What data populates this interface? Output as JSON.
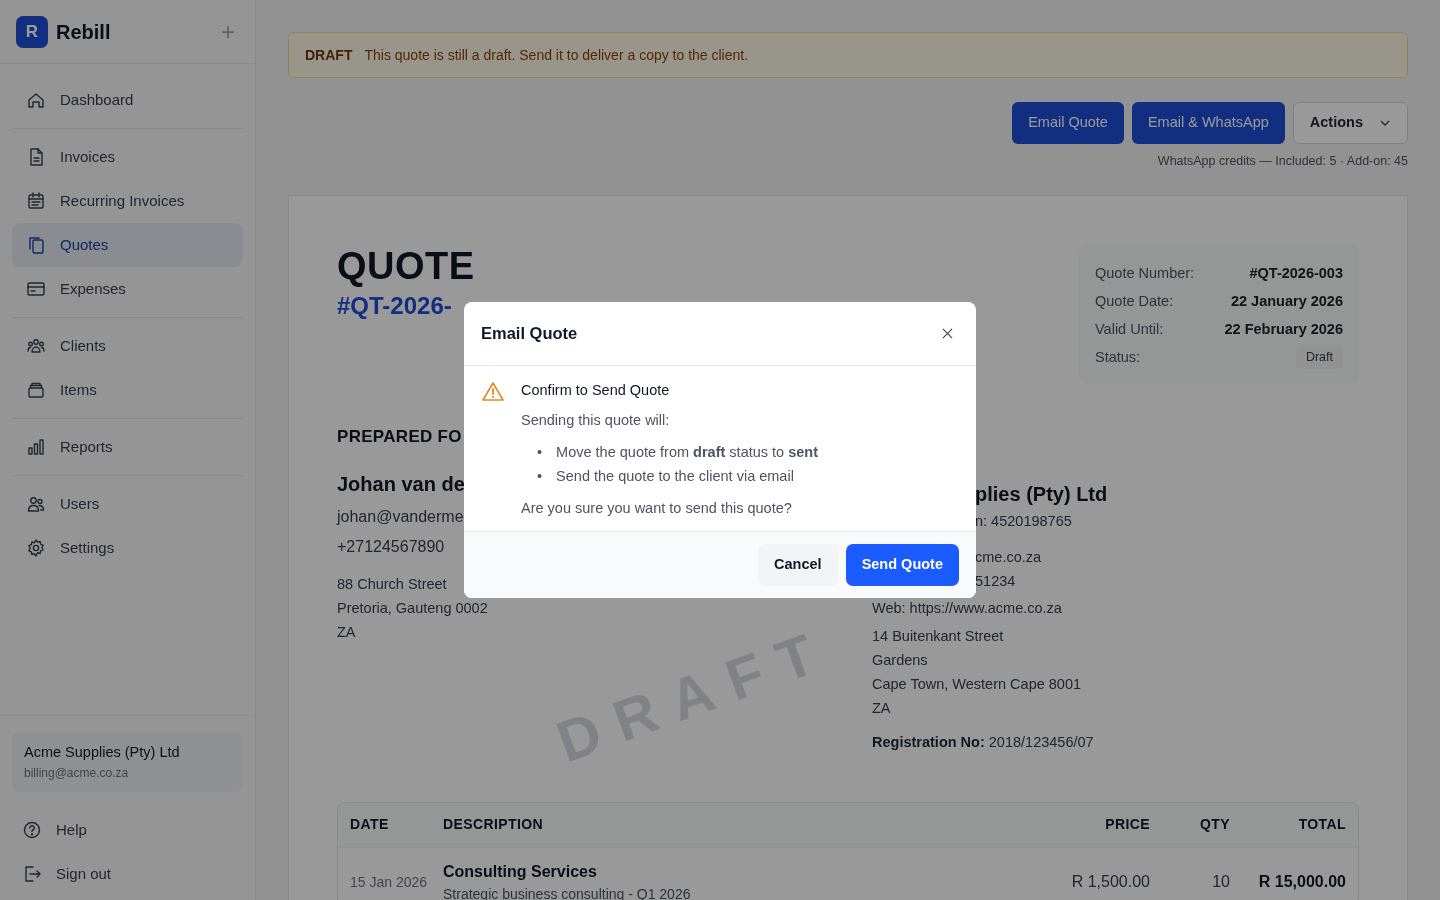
{
  "app": {
    "logo_letter": "R",
    "name": "Rebill",
    "add_button": "+"
  },
  "sidebar": {
    "groups": [
      [
        {
          "label": "Dashboard",
          "selected": false
        }
      ],
      [
        {
          "label": "Invoices",
          "selected": false
        },
        {
          "label": "Recurring Invoices",
          "selected": false
        },
        {
          "label": "Quotes",
          "selected": true
        },
        {
          "label": "Expenses",
          "selected": false
        }
      ],
      [
        {
          "label": "Clients",
          "selected": false
        },
        {
          "label": "Items",
          "selected": false
        }
      ],
      [
        {
          "label": "Reports",
          "selected": false
        }
      ],
      [
        {
          "label": "Users",
          "selected": false
        },
        {
          "label": "Settings",
          "selected": false
        }
      ]
    ],
    "account": {
      "name": "Acme Supplies (Pty) Ltd",
      "email": "billing@acme.co.za"
    },
    "footer": [
      {
        "label": "Help"
      },
      {
        "label": "Sign out"
      }
    ]
  },
  "alert": {
    "tag": "DRAFT",
    "message": "This quote is still a draft. Send it to deliver a copy to the client."
  },
  "actions": [
    {
      "label": "Email Quote",
      "kind": "primary"
    },
    {
      "label": "Email & WhatsApp",
      "kind": "primary"
    },
    {
      "label": "Actions",
      "kind": "dropdown"
    }
  ],
  "credits": "WhatsApp credits — Included: 5 · Add-on: 45",
  "quote": {
    "title": "QUOTE",
    "number": "#QT-2026-",
    "watermark": "DRAFT",
    "details": [
      {
        "label": "Quote Number:",
        "value": "#QT-2026-003",
        "kind": "text"
      },
      {
        "label": "Quote Date:",
        "value": "22 January 2026",
        "kind": "text"
      },
      {
        "label": "Valid Until:",
        "value": "22 February 2026",
        "kind": "text"
      },
      {
        "label": "Status:",
        "value": "Draft",
        "kind": "badge"
      }
    ],
    "prepared_heading": "PREPARED FO",
    "client": [
      {
        "text": "Johan van de",
        "kind": "name"
      },
      {
        "text": "johan@vanderme",
        "kind": "contact"
      },
      {
        "text": "+27124567890",
        "kind": "contact"
      },
      {
        "text": "88 Church Street",
        "kind": "address"
      },
      {
        "text": "Pretoria, Gauteng 0002",
        "kind": "address"
      },
      {
        "text": "ZA",
        "kind": "address"
      }
    ],
    "sender": [
      {
        "text": "plies (Pty) Ltd",
        "kind": "name",
        "cut": true
      },
      {
        "text": "n: 4520198765",
        "kind": "detail",
        "cut": true
      },
      {
        "text": "cme.co.za",
        "kind": "gap",
        "cut": true
      },
      {
        "text": "51234",
        "kind": "detail",
        "cut": true
      },
      {
        "text": "Web: https://www.acme.co.za",
        "kind": "detail",
        "cut": false
      },
      {
        "text": "14 Buitenkant Street",
        "kind": "address",
        "cut": false
      },
      {
        "text": "Gardens",
        "kind": "address",
        "cut": false
      },
      {
        "text": "Cape Town, Western Cape 8001",
        "kind": "address",
        "cut": false
      },
      {
        "text": "ZA",
        "kind": "address",
        "cut": false
      },
      {
        "text": "**Registration No:** 2018/123456/07",
        "kind": "reg",
        "cut": false
      }
    ]
  },
  "table": {
    "columns": [
      "DATE",
      "DESCRIPTION",
      "PRICE",
      "QTY",
      "TOTAL"
    ],
    "rows": [
      {
        "date": "15 Jan 2026",
        "title": "Consulting Services",
        "description": "Strategic business consulting - Q1 2026",
        "price": "R 1,500.00",
        "qty": "10",
        "total": "R 15,000.00"
      }
    ]
  },
  "modal": {
    "title": "Email Quote",
    "heading": "Confirm to Send Quote",
    "intro": "Sending this quote will:",
    "bullet_marker": "•",
    "bullets": [
      "Move the quote from **draft** status to **sent**",
      "Send the quote to the client via email"
    ],
    "question": "Are you sure you want to send this quote?",
    "buttons": [
      {
        "label": "Cancel",
        "kind": "secondary"
      },
      {
        "label": "Send Quote",
        "kind": "primary"
      }
    ]
  }
}
